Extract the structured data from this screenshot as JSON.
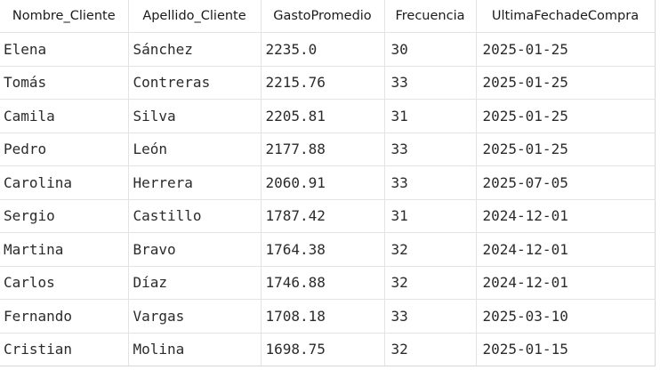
{
  "grid": {
    "columns": [
      "Nombre_Cliente",
      "Apellido_Cliente",
      "GastoPromedio",
      "Frecuencia",
      "UltimaFechadeCompra"
    ],
    "rows": [
      [
        "Elena",
        "Sánchez",
        "2235.0",
        "30",
        "2025-01-25"
      ],
      [
        "Tomás",
        "Contreras",
        "2215.76",
        "33",
        "2025-01-25"
      ],
      [
        "Camila",
        "Silva",
        "2205.81",
        "31",
        "2025-01-25"
      ],
      [
        "Pedro",
        "León",
        "2177.88",
        "33",
        "2025-01-25"
      ],
      [
        "Carolina",
        "Herrera",
        "2060.91",
        "33",
        "2025-07-05"
      ],
      [
        "Sergio",
        "Castillo",
        "1787.42",
        "31",
        "2024-12-01"
      ],
      [
        "Martina",
        "Bravo",
        "1764.38",
        "32",
        "2024-12-01"
      ],
      [
        "Carlos",
        "Díaz",
        "1746.88",
        "32",
        "2024-12-01"
      ],
      [
        "Fernando",
        "Vargas",
        "1708.18",
        "33",
        "2025-03-10"
      ],
      [
        "Cristian",
        "Molina",
        "1698.75",
        "32",
        "2025-01-15"
      ]
    ]
  }
}
